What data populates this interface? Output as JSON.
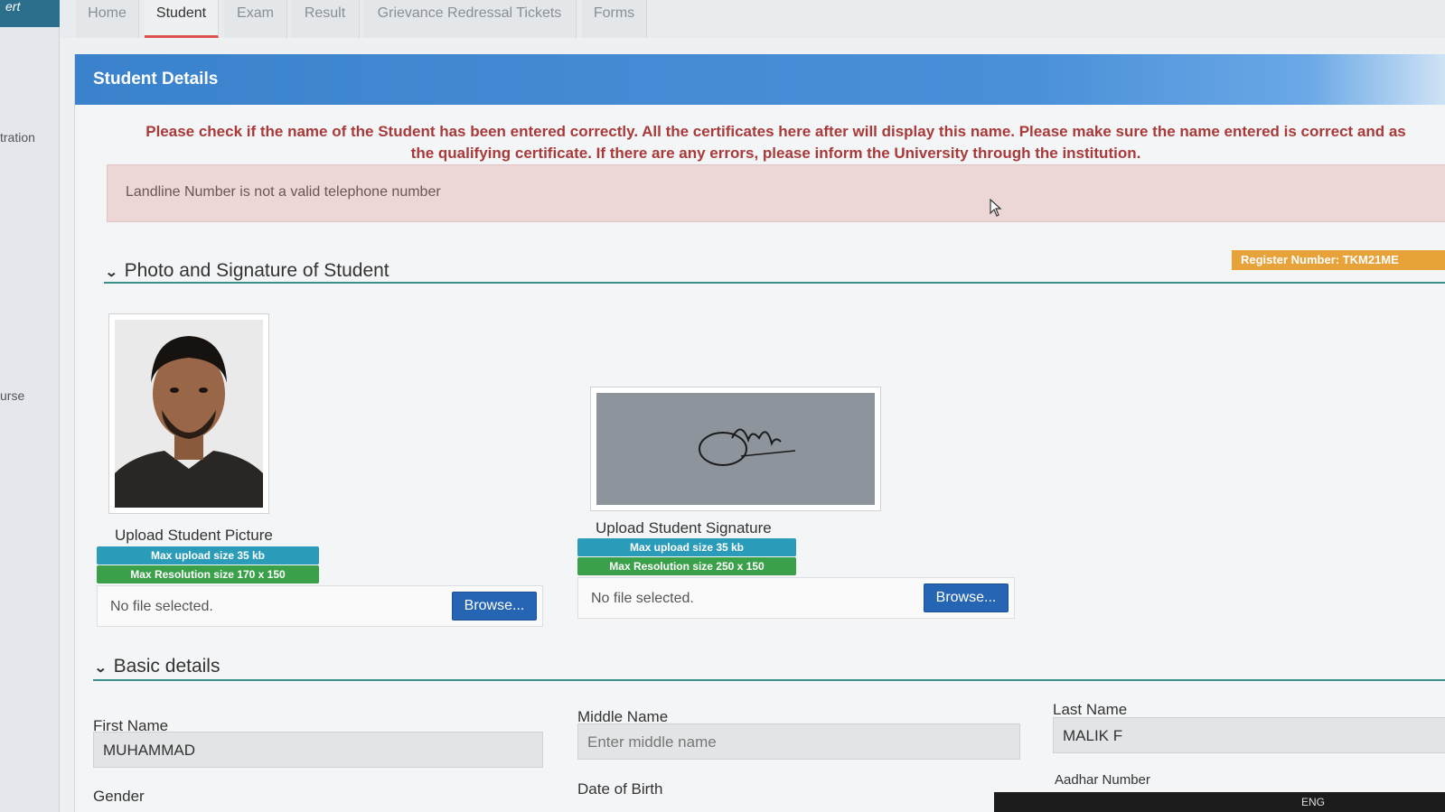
{
  "sidebar": {
    "brand": "ert",
    "items": [
      {
        "label": "tration"
      },
      {
        "label": "urse"
      }
    ]
  },
  "tabs": [
    {
      "label": "Home",
      "active": false
    },
    {
      "label": "Student",
      "active": true
    },
    {
      "label": "Exam",
      "active": false
    },
    {
      "label": "Result",
      "active": false
    },
    {
      "label": "Grievance Redressal Tickets",
      "active": false
    },
    {
      "label": "Forms",
      "active": false
    }
  ],
  "panel": {
    "title": "Student Details",
    "notice_line1": "Please check if the name of the Student has been entered correctly. All the certificates here after will display this name. Please make sure the name entered is correct and as",
    "notice_line2": "the qualifying certificate. If there are any errors, please inform the University through the institution.",
    "alert": "Landline Number is not a valid telephone number"
  },
  "photo_section": {
    "title": "Photo and Signature of Student",
    "register_badge": "Register Number: TKM21ME",
    "picture": {
      "label": "Upload Student Picture",
      "max_size": "Max upload size 35 kb",
      "max_resolution": "Max Resolution size 170 x 150",
      "file_status": "No file selected.",
      "browse": "Browse..."
    },
    "signature": {
      "label": "Upload Student Signature",
      "max_size": "Max upload size 35 kb",
      "max_resolution": "Max Resolution size 250 x 150",
      "file_status": "No file selected.",
      "browse": "Browse..."
    }
  },
  "basic_details": {
    "title": "Basic details",
    "first_name": {
      "label": "First Name",
      "value": "MUHAMMAD"
    },
    "middle_name": {
      "label": "Middle Name",
      "placeholder": "Enter middle name"
    },
    "last_name": {
      "label": "Last Name",
      "value": "MALIK F"
    },
    "gender_label": "Gender",
    "dob_label": "Date of Birth",
    "aadhar_label": "Aadhar Number"
  },
  "taskbar": {
    "lang": "ENG"
  },
  "colors": {
    "header_blue": "#3b82cc",
    "notice_red": "#a83a3a",
    "alert_bg": "#ecd6d6",
    "badge_orange": "#e8a23a",
    "teal_pill": "#2a9bb8",
    "green_pill": "#3aa04a",
    "browse_blue": "#2565b4",
    "section_rule": "#3a8f8a"
  }
}
